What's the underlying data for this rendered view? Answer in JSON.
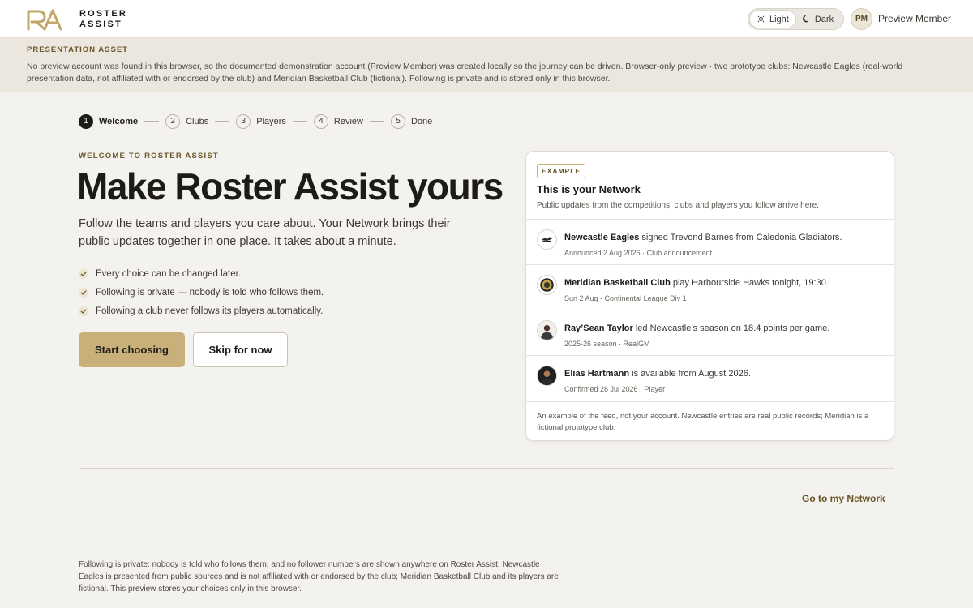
{
  "brand": {
    "line1": "ROSTER",
    "line2": "ASSIST",
    "accent": "#c9b07a"
  },
  "theme": {
    "light_label": "Light",
    "dark_label": "Dark",
    "selected": "Light"
  },
  "user": {
    "initials": "PM",
    "name": "Preview Member"
  },
  "banner": {
    "title": "PRESENTATION ASSET",
    "text": "No preview account was found in this browser, so the documented demonstration account (Preview Member) was created locally so the journey can be driven. Browser-only preview · two prototype clubs: Newcastle Eagles (real-world presentation data, not affiliated with or endorsed by the club) and Meridian Basketball Club (fictional). Following is private and is stored only in this browser."
  },
  "stepper": {
    "steps": [
      {
        "num": "1",
        "label": "Welcome",
        "active": true
      },
      {
        "num": "2",
        "label": "Clubs"
      },
      {
        "num": "3",
        "label": "Players"
      },
      {
        "num": "4",
        "label": "Review"
      },
      {
        "num": "5",
        "label": "Done"
      }
    ]
  },
  "hero": {
    "eyebrow": "WELCOME TO ROSTER ASSIST",
    "title": "Make Roster Assist yours",
    "subtitle": "Follow the teams and players you care about. Your Network brings their public updates together in one place. It takes about a minute.",
    "checks": [
      "Every choice can be changed later.",
      "Following is private — nobody is told who follows them.",
      "Following a club never follows its players automatically."
    ],
    "primary_button": "Start choosing",
    "secondary_button": "Skip for now"
  },
  "example_card": {
    "badge": "EXAMPLE",
    "title": "This is your Network",
    "subtitle": "Public updates from the competitions, clubs and players you follow arrive here.",
    "items": [
      {
        "subject": "Newcastle Eagles",
        "text": " signed Trevond Barnes from Caledonia Gladiators.",
        "meta": "Announced 2 Aug 2026 · Club announcement",
        "icon": "eagles-logo-icon"
      },
      {
        "subject": "Meridian Basketball Club",
        "text": " play Harbourside Hawks tonight, 19:30.",
        "meta": "Sun 2 Aug · Continental League Div 1",
        "icon": "meridian-crest-icon"
      },
      {
        "subject": "Ray’Sean Taylor",
        "text": " led Newcastle’s season on 18.4 points per game.",
        "meta": "2025-26 season · RealGM",
        "icon": "player-photo-icon"
      },
      {
        "subject": "Elias Hartmann",
        "text": " is available from August 2026.",
        "meta": "Confirmed 26 Jul 2026 · Player",
        "icon": "player-photo-icon"
      }
    ],
    "footer": "An example of the feed, not your account. Newcastle entries are real public records; Meridian is a fictional prototype club."
  },
  "network_link": "Go to my Network",
  "footer_note": "Following is private: nobody is told who follows them, and no follower numbers are shown anywhere on Roster Assist. Newcastle Eagles is presented from public sources and is not affiliated with or endorsed by the club; Meridian Basketball Club and its players are fictional. This preview stores your choices only in this browser."
}
